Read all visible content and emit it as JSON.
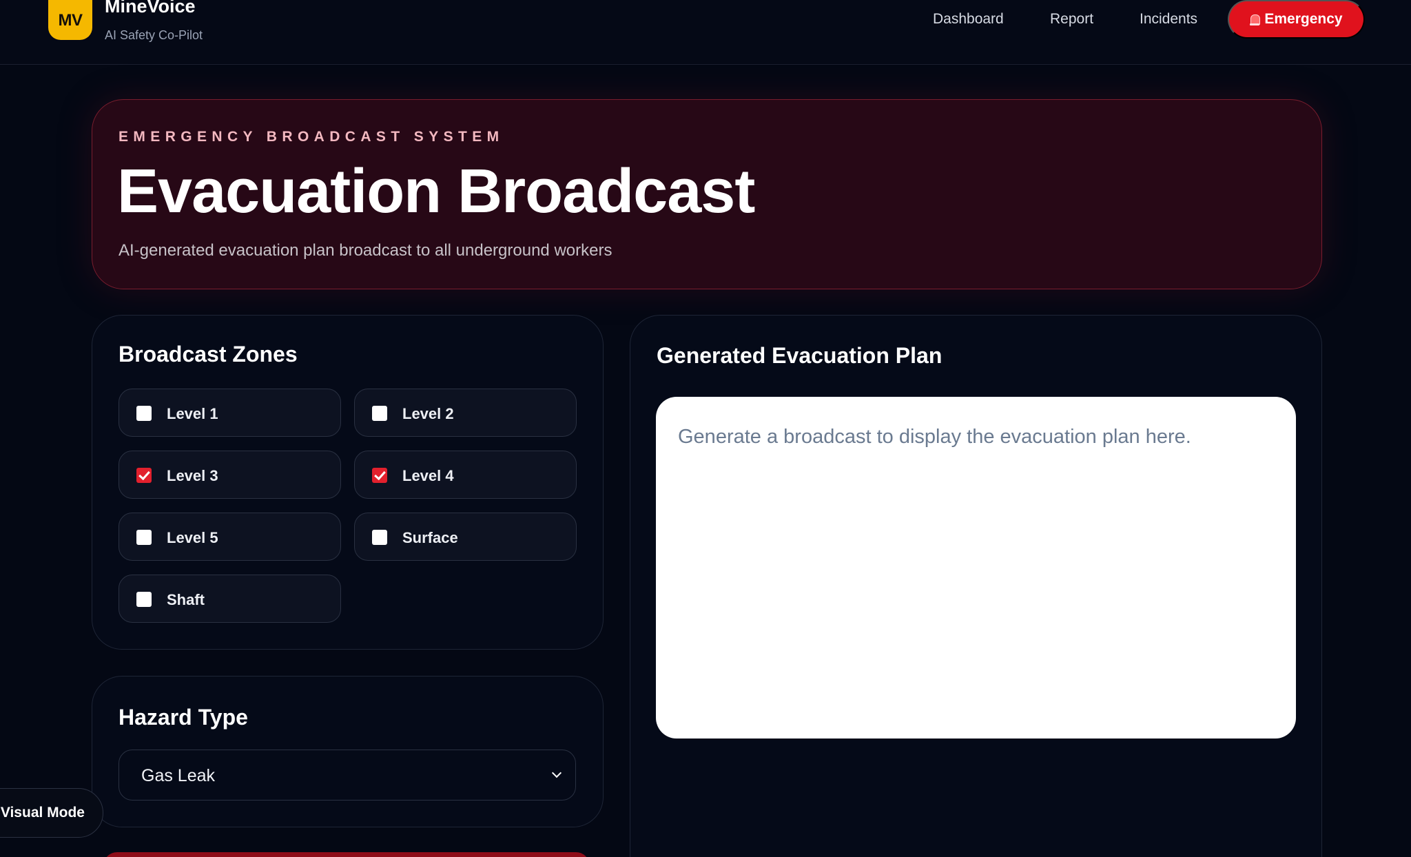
{
  "header": {
    "logo_text": "MV",
    "app_name": "MineVoice",
    "app_tagline": "AI Safety Co-Pilot",
    "nav": [
      {
        "label": "Dashboard"
      },
      {
        "label": "Report"
      },
      {
        "label": "Incidents"
      }
    ],
    "emergency_label": "Emergency",
    "emergency_icon": "siren-icon"
  },
  "hero": {
    "kicker": "EMERGENCY BROADCAST SYSTEM",
    "title": "Evacuation Broadcast",
    "subtitle": "AI-generated evacuation plan broadcast to all underground workers"
  },
  "zones": {
    "title": "Broadcast Zones",
    "items": [
      {
        "label": "Level 1",
        "checked": false
      },
      {
        "label": "Level 2",
        "checked": false
      },
      {
        "label": "Level 3",
        "checked": true
      },
      {
        "label": "Level 4",
        "checked": true
      },
      {
        "label": "Level 5",
        "checked": false
      },
      {
        "label": "Surface",
        "checked": false
      },
      {
        "label": "Shaft",
        "checked": false
      }
    ]
  },
  "hazard": {
    "title": "Hazard Type",
    "selected": "Gas Leak"
  },
  "plan": {
    "title": "Generated Evacuation Plan",
    "placeholder": "Generate a broadcast to display the evacuation plan here."
  },
  "visual_mode_label": "Visual Mode",
  "colors": {
    "background": "#040814",
    "accent_red": "#e0121d",
    "logo_yellow": "#f5b800",
    "hero_background": "#270816"
  }
}
